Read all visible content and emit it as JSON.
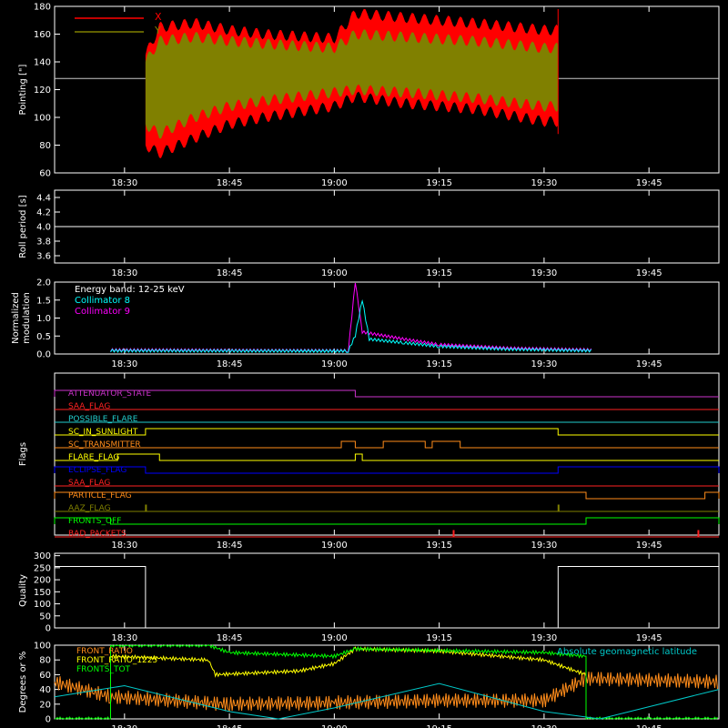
{
  "panels": {
    "pointing": {
      "ylabel": "Pointing [\"]",
      "legend": [
        "X",
        "Y"
      ]
    },
    "roll": {
      "ylabel": "Roll period [s]"
    },
    "modulation": {
      "ylabel_line1": "Normalized",
      "ylabel_line2": "modulation",
      "legend": [
        "Energy band: 12-25 keV",
        "Collimator 8",
        "Collimator 9"
      ]
    },
    "flags": {
      "ylabel": "Flags"
    },
    "quality": {
      "ylabel": "Quality"
    },
    "bottom": {
      "ylabel": "Degrees or %",
      "legend": [
        "FRONT_RATIO",
        "FRONT_RATIO_1225",
        "FRONTS_TOT"
      ],
      "right_label": "Absolute geomagnetic latitude"
    }
  },
  "colors": {
    "axis": "#ffffff",
    "x_series": "#ff0000",
    "y_series": "#808000",
    "collimator8": "#00ffff",
    "collimator9": "#ff00ff",
    "front_ratio": "#ff8c1a",
    "front_ratio_1225": "#ffff00",
    "fronts_tot": "#00ff00",
    "latitude": "#00c8c8"
  },
  "chart_data": [
    {
      "type": "area",
      "title": "",
      "ylabel": "Pointing [\"]",
      "x_ticks": [
        "18:30",
        "18:45",
        "19:00",
        "19:15",
        "19:30",
        "19:45"
      ],
      "y_ticks": [
        60,
        80,
        100,
        120,
        140,
        160,
        180
      ],
      "ylim": [
        60,
        180
      ],
      "xlim": [
        "18:20",
        "19:55"
      ],
      "reference_line": 128,
      "data_start": "18:33",
      "data_end": "19:32",
      "series": [
        {
          "name": "X",
          "upper": [
            [
              "18:33",
              145
            ],
            [
              "18:35",
              165
            ],
            [
              "18:40",
              168
            ],
            [
              "18:45",
              163
            ],
            [
              "18:50",
              160
            ],
            [
              "19:00",
              157
            ],
            [
              "19:03",
              175
            ],
            [
              "19:10",
              172
            ],
            [
              "19:20",
              168
            ],
            [
              "19:30",
              163
            ]
          ],
          "lower": [
            [
              "18:33",
              80
            ],
            [
              "18:35",
              74
            ],
            [
              "18:40",
              85
            ],
            [
              "18:45",
              95
            ],
            [
              "18:50",
              100
            ],
            [
              "19:00",
              108
            ],
            [
              "19:03",
              115
            ],
            [
              "19:10",
              110
            ],
            [
              "19:20",
              106
            ],
            [
              "19:30",
              97
            ]
          ]
        },
        {
          "name": "Y",
          "upper": [
            [
              "18:33",
              140
            ],
            [
              "18:35",
              155
            ],
            [
              "18:40",
              158
            ],
            [
              "18:45",
              155
            ],
            [
              "18:50",
              153
            ],
            [
              "19:00",
              150
            ],
            [
              "19:03",
              160
            ],
            [
              "19:10",
              158
            ],
            [
              "19:20",
              155
            ],
            [
              "19:30",
              150
            ]
          ],
          "lower": [
            [
              "18:33",
              95
            ],
            [
              "18:35",
              88
            ],
            [
              "18:40",
              100
            ],
            [
              "18:45",
              108
            ],
            [
              "18:50",
              112
            ],
            [
              "19:00",
              118
            ],
            [
              "19:03",
              120
            ],
            [
              "19:10",
              118
            ],
            [
              "19:20",
              114
            ],
            [
              "19:30",
              108
            ]
          ]
        }
      ]
    },
    {
      "type": "line",
      "ylabel": "Roll period [s]",
      "x_ticks": [
        "18:30",
        "18:45",
        "19:00",
        "19:15",
        "19:30",
        "19:45"
      ],
      "y_ticks": [
        3.6,
        3.8,
        4.0,
        4.2,
        4.4
      ],
      "ylim": [
        3.5,
        4.5
      ],
      "series": [
        {
          "values": [
            [
              "18:20",
              4.0
            ],
            [
              "19:55",
              4.0
            ]
          ]
        }
      ]
    },
    {
      "type": "line",
      "ylabel": "Normalized modulation",
      "x_ticks": [
        "18:30",
        "18:45",
        "19:00",
        "19:15",
        "19:30",
        "19:45"
      ],
      "y_ticks": [
        0.0,
        0.5,
        1.0,
        1.5,
        2.0
      ],
      "ylim": [
        0,
        2
      ],
      "series": [
        {
          "name": "Collimator 8",
          "values": [
            [
              "18:28",
              0.08
            ],
            [
              "19:02",
              0.07
            ],
            [
              "19:03",
              0.5
            ],
            [
              "19:04",
              1.5
            ],
            [
              "19:05",
              0.4
            ],
            [
              "19:10",
              0.3
            ],
            [
              "19:15",
              0.2
            ],
            [
              "19:25",
              0.12
            ],
            [
              "19:37",
              0.08
            ]
          ]
        },
        {
          "name": "Collimator 9",
          "values": [
            [
              "18:28",
              0.1
            ],
            [
              "19:02",
              0.08
            ],
            [
              "19:03",
              2.0
            ],
            [
              "19:04",
              0.6
            ],
            [
              "19:07",
              0.5
            ],
            [
              "19:10",
              0.4
            ],
            [
              "19:15",
              0.25
            ],
            [
              "19:25",
              0.15
            ],
            [
              "19:37",
              0.1
            ]
          ]
        }
      ]
    },
    {
      "type": "table",
      "ylabel": "Flags",
      "x_ticks": [
        "18:30",
        "18:45",
        "19:00",
        "19:15",
        "19:30",
        "19:45"
      ],
      "flags": [
        {
          "name": "ATTENUATOR_STATE",
          "color": "#cc33cc",
          "on": [
            [
              "18:20",
              "19:03"
            ]
          ]
        },
        {
          "name": "SAA_FLAG",
          "color": "#ff2222",
          "on": []
        },
        {
          "name": "POSSIBLE_FLARE",
          "color": "#22cccc",
          "on": []
        },
        {
          "name": "SC_IN_SUNLIGHT",
          "color": "#ffff00",
          "on": [
            [
              "18:33",
              "19:32"
            ]
          ]
        },
        {
          "name": "SC_TRANSMITTER",
          "color": "#ff8c1a",
          "on": [
            [
              "19:01",
              "19:03"
            ],
            [
              "19:07",
              "19:13"
            ],
            [
              "19:14",
              "19:18"
            ]
          ]
        },
        {
          "name": "FLARE_FLAG",
          "color": "#ffff00",
          "on": [
            [
              "18:29",
              "18:35"
            ],
            [
              "19:03",
              "19:04"
            ]
          ]
        },
        {
          "name": "ECLIPSE_FLAG",
          "color": "#0000ff",
          "on": [
            [
              "18:20",
              "18:33"
            ],
            [
              "19:32",
              "19:55"
            ]
          ]
        },
        {
          "name": "SAA_FLAG",
          "color": "#ff2222",
          "on": []
        },
        {
          "name": "PARTICLE_FLAG",
          "color": "#ff8c1a",
          "on": [
            [
              "18:20",
              "19:36"
            ],
            [
              "19:53",
              "19:55"
            ]
          ]
        },
        {
          "name": "AAZ_FLAG",
          "color": "#808000",
          "on": [
            [
              "18:33",
              "18:33"
            ],
            [
              "19:32",
              "19:32"
            ]
          ]
        },
        {
          "name": "FRONTS_OFF",
          "color": "#00ff00",
          "on": [
            [
              "18:20",
              "18:28"
            ],
            [
              "19:36",
              "19:55"
            ]
          ]
        },
        {
          "name": "BAD_PACKETS",
          "color": "#ff2222",
          "on": [
            [
              "19:17",
              "19:17"
            ],
            [
              "19:52",
              "19:52"
            ]
          ]
        }
      ]
    },
    {
      "type": "line",
      "ylabel": "Quality",
      "x_ticks": [
        "18:30",
        "18:45",
        "19:00",
        "19:15",
        "19:30",
        "19:45"
      ],
      "y_ticks": [
        0,
        50,
        100,
        150,
        200,
        250,
        300
      ],
      "ylim": [
        0,
        310
      ],
      "series": [
        {
          "values": [
            [
              "18:20",
              255
            ],
            [
              "18:33",
              255
            ],
            [
              "18:33",
              0
            ],
            [
              "19:32",
              0
            ],
            [
              "19:32",
              255
            ],
            [
              "19:55",
              255
            ]
          ]
        }
      ]
    },
    {
      "type": "line",
      "ylabel": "Degrees or %",
      "x_ticks": [
        "18:30",
        "18:45",
        "19:00",
        "19:15",
        "19:30",
        "19:45"
      ],
      "y_ticks": [
        0,
        20,
        40,
        60,
        80,
        100
      ],
      "ylim": [
        0,
        100
      ],
      "series": [
        {
          "name": "FRONT_RATIO",
          "values": [
            [
              "18:20",
              50
            ],
            [
              "18:28",
              30
            ],
            [
              "18:45",
              20
            ],
            [
              "19:00",
              22
            ],
            [
              "19:15",
              25
            ],
            [
              "19:30",
              25
            ],
            [
              "19:36",
              55
            ],
            [
              "19:55",
              50
            ]
          ]
        },
        {
          "name": "FRONT_RATIO_1225",
          "values": [
            [
              "18:28",
              85
            ],
            [
              "18:42",
              80
            ],
            [
              "18:43",
              60
            ],
            [
              "18:55",
              65
            ],
            [
              "19:00",
              75
            ],
            [
              "19:03",
              95
            ],
            [
              "19:15",
              92
            ],
            [
              "19:30",
              80
            ],
            [
              "19:36",
              60
            ]
          ]
        },
        {
          "name": "FRONTS_TOT",
          "values": [
            [
              "18:20",
              0
            ],
            [
              "18:28",
              0
            ],
            [
              "18:28",
              100
            ],
            [
              "18:42",
              100
            ],
            [
              "18:45",
              90
            ],
            [
              "19:00",
              85
            ],
            [
              "19:03",
              95
            ],
            [
              "19:30",
              90
            ],
            [
              "19:36",
              85
            ],
            [
              "19:36",
              0
            ],
            [
              "19:55",
              0
            ]
          ]
        },
        {
          "name": "Absolute geomagnetic latitude",
          "values": [
            [
              "18:20",
              30
            ],
            [
              "18:30",
              45
            ],
            [
              "18:45",
              10
            ],
            [
              "18:52",
              0
            ],
            [
              "19:00",
              15
            ],
            [
              "19:15",
              48
            ],
            [
              "19:30",
              10
            ],
            [
              "19:38",
              0
            ],
            [
              "19:55",
              40
            ]
          ]
        }
      ]
    }
  ]
}
